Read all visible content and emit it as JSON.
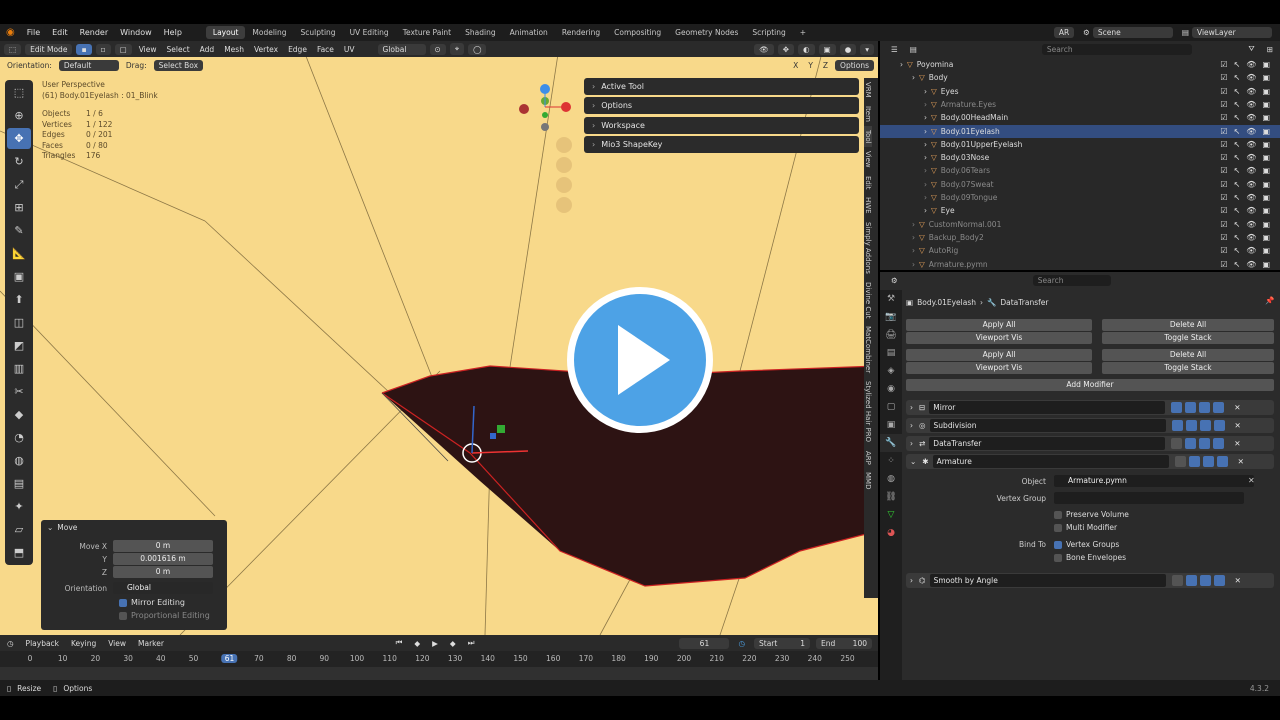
{
  "menu": [
    "File",
    "Edit",
    "Render",
    "Window",
    "Help"
  ],
  "workspaces": [
    "Layout",
    "Modeling",
    "Sculpting",
    "UV Editing",
    "Texture Paint",
    "Shading",
    "Animation",
    "Rendering",
    "Compositing",
    "Geometry Nodes",
    "Scripting"
  ],
  "active_workspace": "Layout",
  "topright": {
    "render_engine": "AR",
    "scene": "Scene",
    "view_layer": "ViewLayer"
  },
  "viewport_header": {
    "mode": "Edit Mode",
    "menus": [
      "View",
      "Select",
      "Add",
      "Mesh",
      "Vertex",
      "Edge",
      "Face",
      "UV"
    ],
    "transform": "Global",
    "orientation_label": "Orientation:",
    "orientation_value": "Default",
    "drag_label": "Drag:",
    "drag_value": "Select Box",
    "options": "Options",
    "axes": [
      "X",
      "Y",
      "Z"
    ]
  },
  "overlay": {
    "view": "User Perspective",
    "object": "(61) Body.01Eyelash : 01_Blink",
    "stats": [
      {
        "k": "Objects",
        "v": "1 / 6"
      },
      {
        "k": "Vertices",
        "v": "1 / 122"
      },
      {
        "k": "Edges",
        "v": "0 / 201"
      },
      {
        "k": "Faces",
        "v": "0 / 80"
      },
      {
        "k": "Triangles",
        "v": "176"
      }
    ]
  },
  "npanel": [
    "Active Tool",
    "Options",
    "Workspace",
    "Mio3 ShapeKey"
  ],
  "side_tabs": [
    "VRM",
    "Item",
    "Tool",
    "View",
    "Edit",
    "HWE",
    "Simply Addons",
    "Divine Cut",
    "MatCombiner",
    "Stylized Hair PRO",
    "ARP",
    "MMD"
  ],
  "operator": {
    "title": "Move",
    "move_x_label": "Move X",
    "move_x": "0 m",
    "y_label": "Y",
    "y": "0.001616 m",
    "z_label": "Z",
    "z": "0 m",
    "orientation_label": "Orientation",
    "orientation": "Global",
    "mirror": "Mirror Editing",
    "proportional": "Proportional Editing"
  },
  "timeline": {
    "menus": [
      "Playback",
      "Keying",
      "View",
      "Marker"
    ],
    "current_frame": "61",
    "start_label": "Start",
    "start": "1",
    "end_label": "End",
    "end": "100",
    "ticks": [
      "0",
      "10",
      "20",
      "30",
      "40",
      "50",
      "61",
      "70",
      "80",
      "90",
      "100",
      "110",
      "120",
      "130",
      "140",
      "150",
      "160",
      "170",
      "180",
      "190",
      "200",
      "210",
      "220",
      "230",
      "240",
      "250"
    ]
  },
  "status": {
    "left1": "Resize",
    "left2": "Options",
    "version": "4.3.2"
  },
  "outliner": {
    "search_placeholder": "Search",
    "rows": [
      {
        "name": "Poyomina",
        "indent": 0,
        "state": "normal"
      },
      {
        "name": "Body",
        "indent": 1,
        "state": "normal"
      },
      {
        "name": "Eyes",
        "indent": 2,
        "state": "normal"
      },
      {
        "name": "Armature.Eyes",
        "indent": 2,
        "state": "dim"
      },
      {
        "name": "Body.00HeadMain",
        "indent": 2,
        "state": "normal"
      },
      {
        "name": "Body.01Eyelash",
        "indent": 2,
        "state": "sel"
      },
      {
        "name": "Body.01UpperEyelash",
        "indent": 2,
        "state": "normal"
      },
      {
        "name": "Body.03Nose",
        "indent": 2,
        "state": "normal"
      },
      {
        "name": "Body.06Tears",
        "indent": 2,
        "state": "dim"
      },
      {
        "name": "Body.07Sweat",
        "indent": 2,
        "state": "dim"
      },
      {
        "name": "Body.09Tongue",
        "indent": 2,
        "state": "dim"
      },
      {
        "name": "Eye",
        "indent": 2,
        "state": "normal"
      },
      {
        "name": "CustomNormal.001",
        "indent": 1,
        "state": "dim"
      },
      {
        "name": "Backup_Body2",
        "indent": 1,
        "state": "dim"
      },
      {
        "name": "AutoRig",
        "indent": 1,
        "state": "dim"
      },
      {
        "name": "Armature.pymn",
        "indent": 1,
        "state": "dim"
      }
    ]
  },
  "properties": {
    "search_placeholder": "Search",
    "breadcrumb_object": "Body.01Eyelash",
    "breadcrumb_mod": "DataTransfer",
    "apply_all": "Apply All",
    "delete_all": "Delete All",
    "viewport_vis": "Viewport Vis",
    "toggle_stack": "Toggle Stack",
    "add_modifier": "Add Modifier",
    "modifiers": [
      "Mirror",
      "Subdivision",
      "DataTransfer",
      "Armature"
    ],
    "armature": {
      "object_label": "Object",
      "object": "Armature.pymn",
      "vgroup_label": "Vertex Group",
      "preserve_volume": "Preserve Volume",
      "multi_modifier": "Multi Modifier",
      "bind_to_label": "Bind To",
      "vertex_groups": "Vertex Groups",
      "bone_envelopes": "Bone Envelopes"
    },
    "smooth": "Smooth by Angle"
  },
  "colors": {
    "accent": "#4772b3",
    "viewport": "#f8d98a",
    "play": "#4da2e6"
  }
}
